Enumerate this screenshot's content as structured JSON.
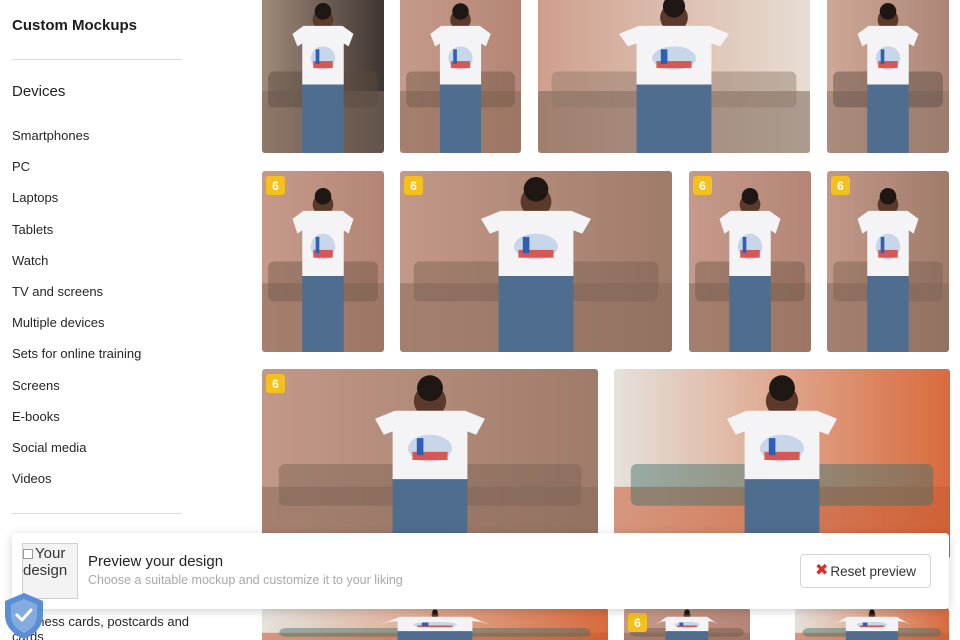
{
  "sidebar": {
    "title": "Custom Mockups",
    "section_heading": "Devices",
    "items": [
      {
        "label": "Smartphones"
      },
      {
        "label": "PC"
      },
      {
        "label": "Laptops"
      },
      {
        "label": "Tablets"
      },
      {
        "label": "Watch"
      },
      {
        "label": "TV and screens"
      },
      {
        "label": "Multiple devices"
      },
      {
        "label": "Sets for online training"
      },
      {
        "label": "Screens"
      },
      {
        "label": "E-books"
      },
      {
        "label": "Social media"
      },
      {
        "label": "Videos"
      }
    ],
    "partially_hidden_item": "Business cards, postcards and cards"
  },
  "gallery": {
    "badge_text": "6",
    "badge_color": "#f4c01b",
    "tiles": [
      {
        "scene": "wall-dark",
        "badge": false
      },
      {
        "scene": "room-pink",
        "badge": false
      },
      {
        "scene": "room-back",
        "badge": false
      },
      {
        "scene": "room-sofa",
        "badge": false
      },
      {
        "scene": "room-pink",
        "badge": true
      },
      {
        "scene": "sofa-wide",
        "badge": true
      },
      {
        "scene": "room-pink",
        "badge": true
      },
      {
        "scene": "sofa-wide",
        "badge": true
      },
      {
        "scene": "sofa-wide",
        "badge": true
      },
      {
        "scene": "orange-mural",
        "badge": false
      },
      {
        "scene": "orange-mural",
        "badge": false
      },
      {
        "scene": "room-pink",
        "badge": false
      },
      {
        "scene": "room-pink",
        "badge": true
      },
      {
        "scene": "orange-mural",
        "badge": false
      }
    ]
  },
  "preview": {
    "thumb_alt": "Your design",
    "title": "Preview your design",
    "subtitle": "Choose a suitable mockup and customize it to your liking",
    "reset_icon": "close-x-icon",
    "reset_label": "Reset preview"
  },
  "security_badge": {
    "icon": "shield-check-icon"
  },
  "colors": {
    "accent_badge": "#f4c01b",
    "reset_x": "#d2322d",
    "shield": "#5a8fd6"
  }
}
